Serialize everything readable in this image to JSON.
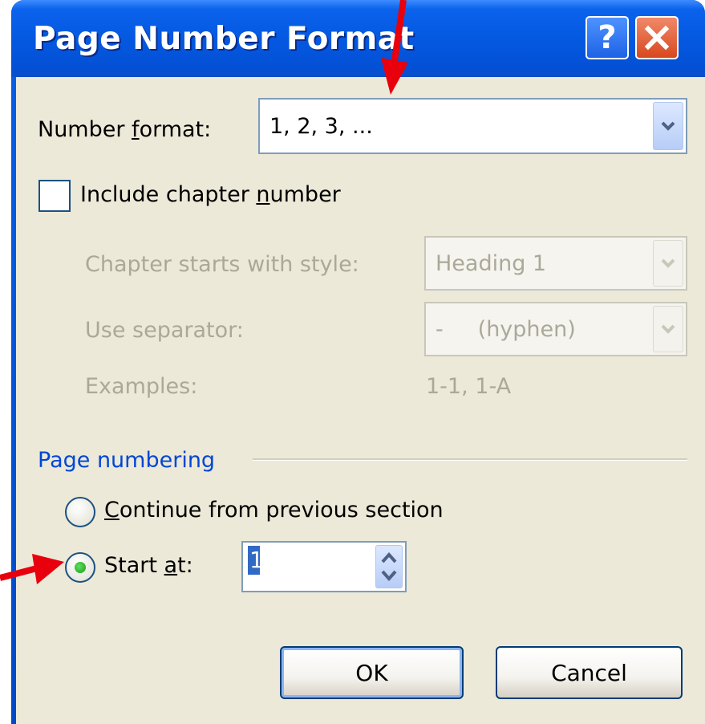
{
  "window": {
    "title": "Page Number Format",
    "help_glyph": "?",
    "close_icon": "close-icon"
  },
  "number_format": {
    "label_pre": "Number ",
    "label_key": "f",
    "label_post": "ormat:",
    "value": "1, 2, 3, ..."
  },
  "include_chapter": {
    "label_pre": "Include chapter ",
    "label_key": "n",
    "label_post": "umber",
    "checked": false
  },
  "chapter_style": {
    "label": "Chapter starts with style:",
    "value": "Heading 1"
  },
  "separator": {
    "label": "Use separator:",
    "value": "-     (hyphen)"
  },
  "examples": {
    "label": "Examples:",
    "value": "1-1, 1-A"
  },
  "page_numbering": {
    "title": "Page numbering",
    "continue_key": "C",
    "continue_rest": "ontinue from previous section",
    "start_pre": "Start ",
    "start_key": "a",
    "start_post": "t:",
    "start_value": "1",
    "selected": "start_at"
  },
  "buttons": {
    "ok": "OK",
    "cancel": "Cancel"
  },
  "colors": {
    "annotation_arrow": "#e8000c",
    "title_bar": "#0458df",
    "dialog_bg": "#ece9d8",
    "group_title": "#0046d5"
  }
}
